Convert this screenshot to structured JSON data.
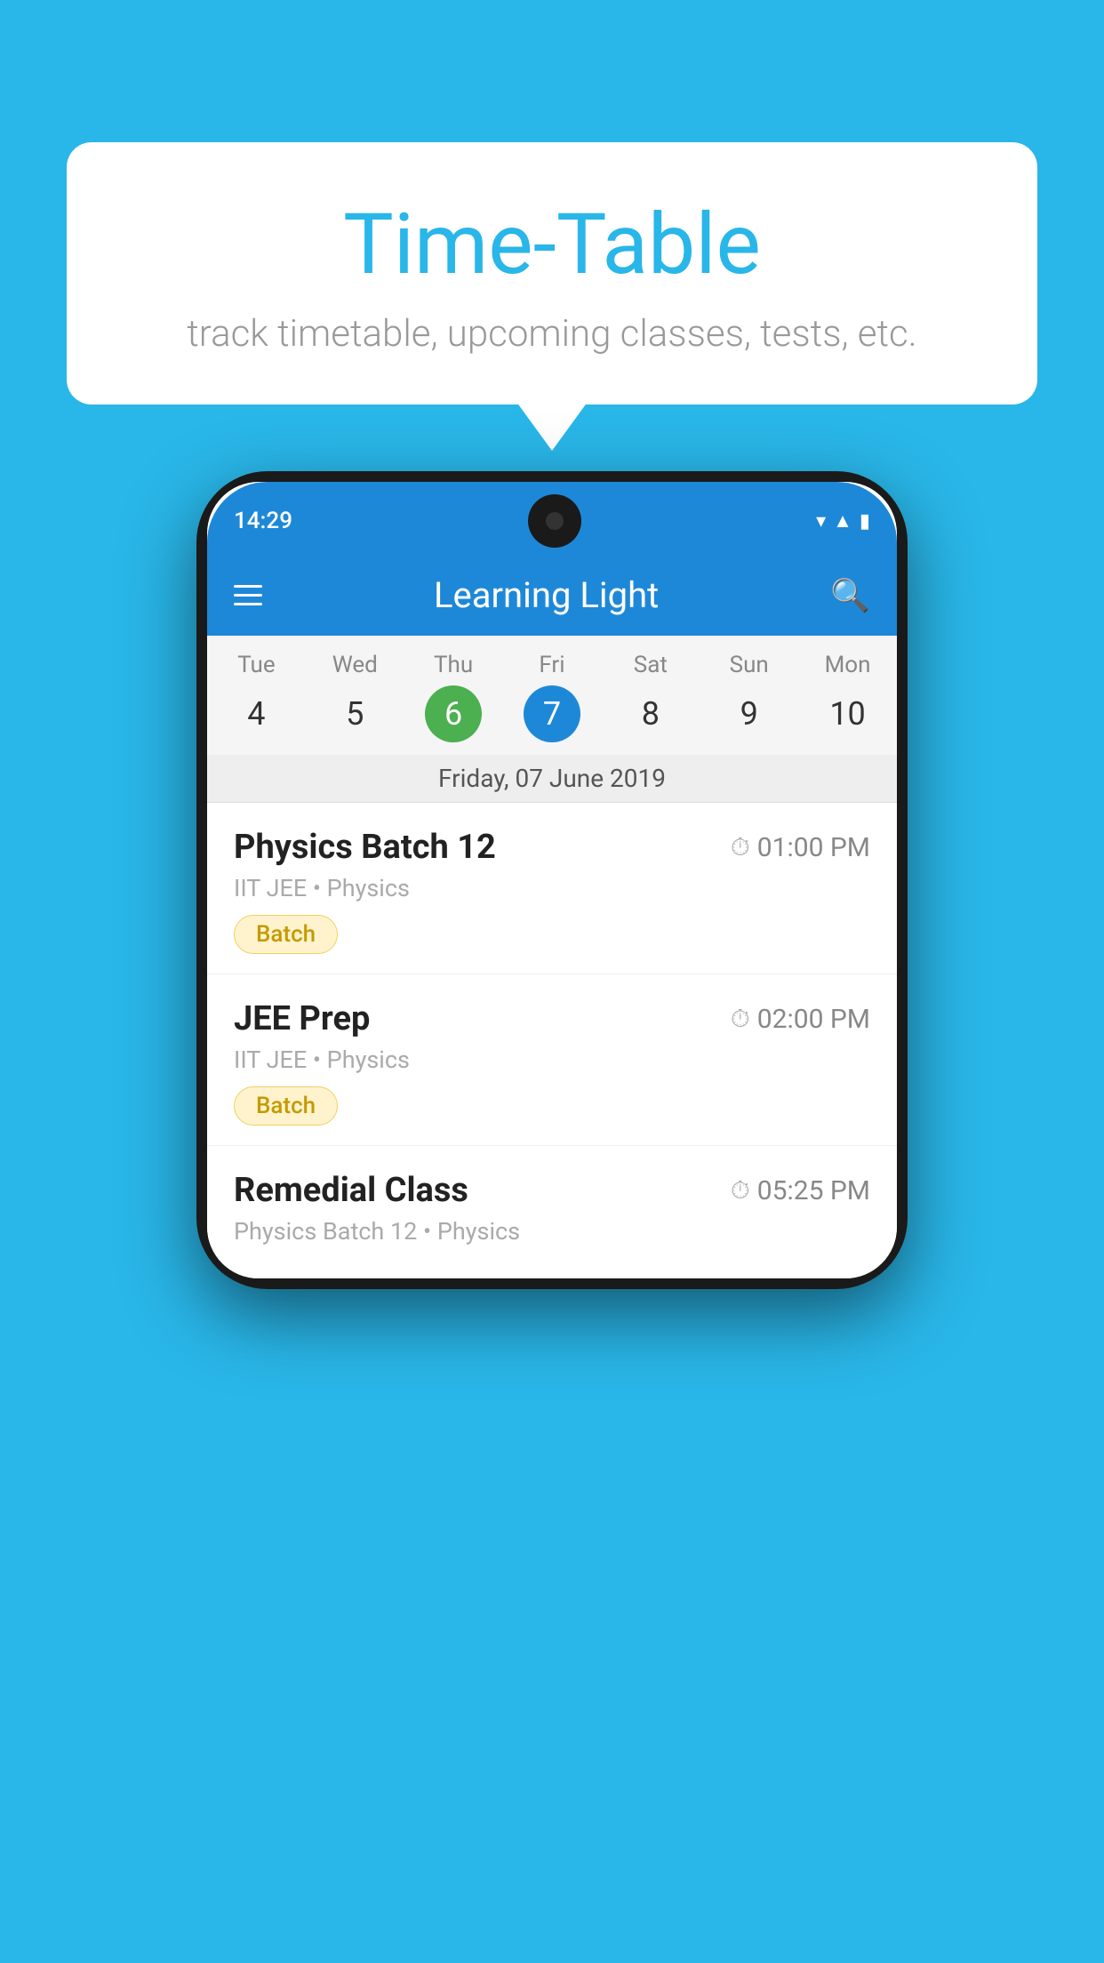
{
  "background_color": "#29b6e8",
  "bubble": {
    "title": "Time-Table",
    "subtitle": "track timetable, upcoming classes, tests, etc."
  },
  "phone": {
    "status_bar": {
      "time": "14:29"
    },
    "app_header": {
      "title": "Learning Light"
    },
    "calendar": {
      "days": [
        "Tue",
        "Wed",
        "Thu",
        "Fri",
        "Sat",
        "Sun",
        "Mon"
      ],
      "dates": [
        "4",
        "5",
        "6",
        "7",
        "8",
        "9",
        "10"
      ],
      "today_index": 2,
      "selected_index": 3,
      "selected_date_label": "Friday, 07 June 2019"
    },
    "schedule": [
      {
        "title": "Physics Batch 12",
        "time": "01:00 PM",
        "meta": "IIT JEE • Physics",
        "badge": "Batch"
      },
      {
        "title": "JEE Prep",
        "time": "02:00 PM",
        "meta": "IIT JEE • Physics",
        "badge": "Batch"
      },
      {
        "title": "Remedial Class",
        "time": "05:25 PM",
        "meta": "Physics Batch 12 • Physics",
        "badge": null
      }
    ]
  }
}
